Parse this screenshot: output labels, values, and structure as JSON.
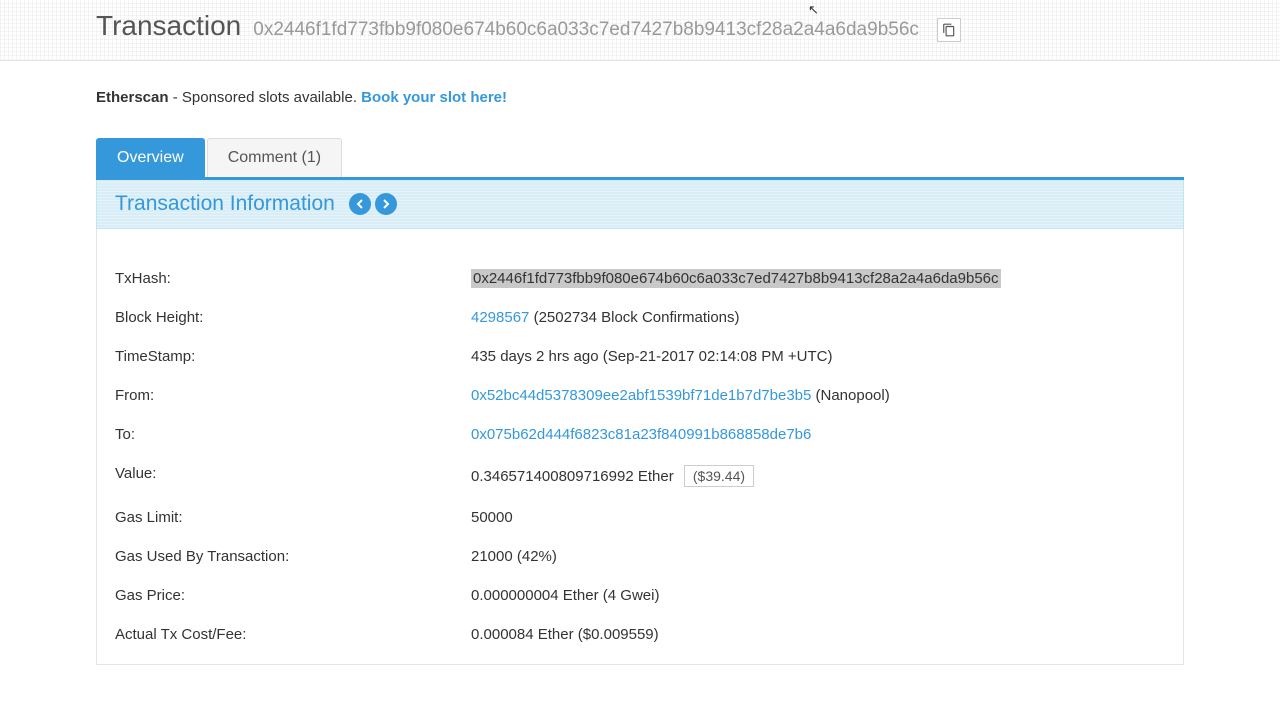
{
  "header": {
    "title": "Transaction",
    "hash": "0x2446f1fd773fbb9f080e674b60c6a033c7ed7427b8b9413cf28a2a4a6da9b56c"
  },
  "sponsor": {
    "brand": "Etherscan",
    "text": " - Sponsored slots available. ",
    "linkText": "Book your slot here!"
  },
  "tabs": {
    "overview": "Overview",
    "comment": "Comment (1)"
  },
  "panel": {
    "title": "Transaction Information"
  },
  "fields": {
    "txhash": {
      "label": "TxHash:",
      "value": "0x2446f1fd773fbb9f080e674b60c6a033c7ed7427b8b9413cf28a2a4a6da9b56c"
    },
    "blockHeight": {
      "label": "Block Height:",
      "link": "4298567",
      "confirmations": " (2502734 Block Confirmations)"
    },
    "timestamp": {
      "label": "TimeStamp:",
      "value": "435 days 2 hrs ago (Sep-21-2017 02:14:08 PM +UTC)"
    },
    "from": {
      "label": "From:",
      "link": "0x52bc44d5378309ee2abf1539bf71de1b7d7be3b5",
      "suffix": " (Nanopool)"
    },
    "to": {
      "label": "To:",
      "link": "0x075b62d444f6823c81a23f840991b868858de7b6"
    },
    "value": {
      "label": "Value:",
      "ether": "0.346571400809716992 Ether",
      "usd": "($39.44)"
    },
    "gasLimit": {
      "label": "Gas Limit:",
      "value": "50000"
    },
    "gasUsed": {
      "label": "Gas Used By Transaction:",
      "value": "21000 (42%)"
    },
    "gasPrice": {
      "label": "Gas Price:",
      "value": "0.000000004 Ether (4 Gwei)"
    },
    "txCost": {
      "label": "Actual Tx Cost/Fee:",
      "value": "0.000084 Ether ($0.009559)"
    }
  }
}
